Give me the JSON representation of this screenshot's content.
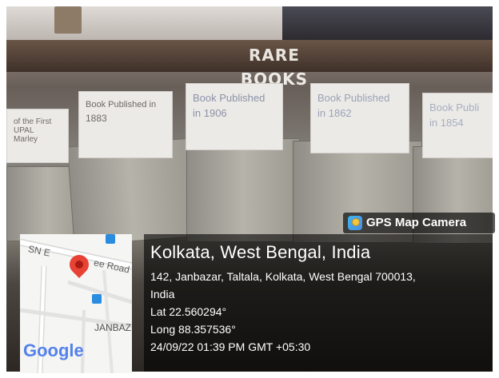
{
  "scene": {
    "shelf_label": "RARE BOOKS",
    "cards": [
      {
        "line1": "of the First",
        "line2": "UPAL",
        "line3": "Marley"
      },
      {
        "line1": "Book Published in",
        "line2": "1883"
      },
      {
        "line1": "Book Published",
        "line2": "in 1906"
      },
      {
        "line1": "Book Published",
        "line2": "in 1862"
      },
      {
        "line1": "Book Publi",
        "line2": "in 1854"
      }
    ]
  },
  "overlay": {
    "app_badge": "GPS Map Camera",
    "map": {
      "road_label_1": "SN E",
      "road_label_2": "ee Road",
      "area_label": "JANBAZ",
      "brand": "Google"
    },
    "location_title": "Kolkata, West Bengal, India",
    "address_line_1": "142, Janbazar, Taltala, Kolkata, West Bengal 700013,",
    "address_line_2": "India",
    "lat": "Lat 22.560294°",
    "long": "Long 88.357536°",
    "timestamp": "24/09/22 01:39 PM GMT +05:30"
  },
  "colors": {
    "pin": "#e84235",
    "panel": "rgba(0,0,0,0.6)",
    "google_blue": "#5481ea"
  }
}
